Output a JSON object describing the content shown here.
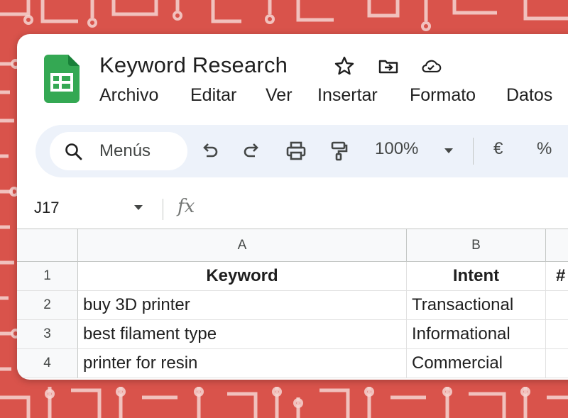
{
  "doc": {
    "title": "Keyword Research"
  },
  "menu": [
    "Archivo",
    "Editar",
    "Ver",
    "Insertar",
    "Formato",
    "Datos"
  ],
  "toolbar": {
    "search_label": "Menús",
    "zoom": "100%",
    "currency": "€",
    "percent": "%"
  },
  "formula_bar": {
    "cell_ref": "J17",
    "fx": "fx",
    "value": ""
  },
  "columns": [
    "A",
    "B"
  ],
  "rows": [
    {
      "num": "1",
      "a": "Keyword",
      "b": "Intent",
      "c": "#"
    },
    {
      "num": "2",
      "a": "buy 3D printer",
      "b": "Transactional",
      "c": ""
    },
    {
      "num": "3",
      "a": "best filament type",
      "b": "Informational",
      "c": ""
    },
    {
      "num": "4",
      "a": "printer for resin",
      "b": "Commercial",
      "c": ""
    }
  ],
  "colors": {
    "background": "#d9534b",
    "sheets_green": "#34a853",
    "toolbar_bg": "#edf2fa",
    "header_bg": "#f8f9fa"
  },
  "icons": [
    "sheets-logo",
    "star-icon",
    "move-to-folder-icon",
    "cloud-saved-icon",
    "search-icon",
    "undo-icon",
    "redo-icon",
    "print-icon",
    "paint-format-icon",
    "dropdown-caret-icon",
    "fx-icon"
  ]
}
